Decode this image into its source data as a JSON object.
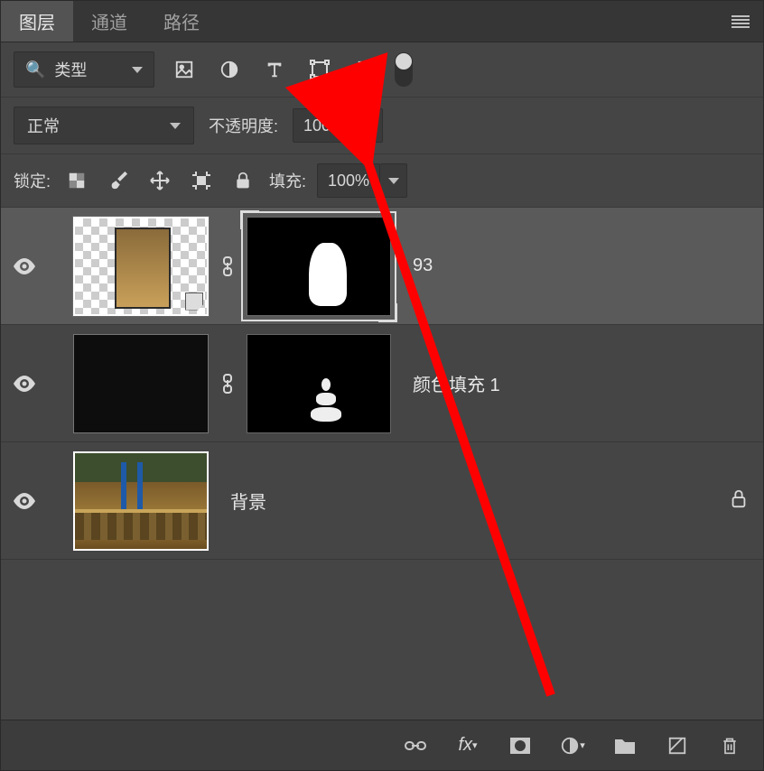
{
  "tabs": {
    "layers": "图层",
    "channels": "通道",
    "paths": "路径"
  },
  "filter": {
    "search_icon": "🔍",
    "type_label": "类型"
  },
  "blend": {
    "mode": "正常",
    "opacity_label": "不透明度:",
    "opacity_value": "100%"
  },
  "lock": {
    "label": "锁定:",
    "fill_label": "填充:",
    "fill_value": "100%"
  },
  "layers": [
    {
      "name": "93",
      "has_mask": true,
      "selected": true,
      "visible": true,
      "linked": true
    },
    {
      "name": "颜色填充 1",
      "has_mask": true,
      "selected": false,
      "visible": true,
      "linked": true
    },
    {
      "name": "背景",
      "has_mask": false,
      "selected": false,
      "visible": true,
      "locked": true
    }
  ],
  "annotation": {
    "arrow_color": "#ff0000"
  }
}
